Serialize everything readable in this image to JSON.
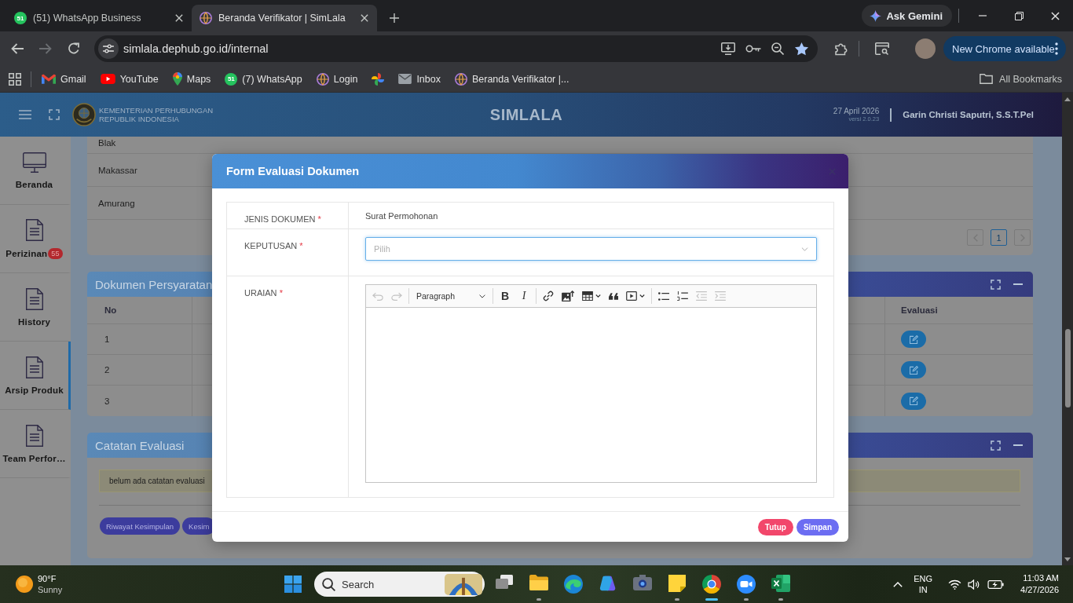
{
  "browser": {
    "tabs": [
      {
        "kind": "whatsapp",
        "badge": "51",
        "title": "(51) WhatsApp Business",
        "selected": false
      },
      {
        "kind": "site",
        "title": "Beranda Verifikator | SimLala",
        "selected": true
      }
    ],
    "gemini_button": "Ask Gemini",
    "navigation": {
      "back_disabled": false,
      "forward_disabled": true
    },
    "url": "simlala.dephub.go.id/internal",
    "bookmarked": true,
    "update_button": "New Chrome available",
    "bookmarks": [
      {
        "kind": "gmail",
        "label": "Gmail"
      },
      {
        "kind": "youtube",
        "label": "YouTube"
      },
      {
        "kind": "maps",
        "label": "Maps"
      },
      {
        "kind": "whatsapp",
        "badge": "51",
        "label": "(7) WhatsApp"
      },
      {
        "kind": "site",
        "label": "Login"
      },
      {
        "kind": "photos"
      },
      {
        "kind": "mail",
        "label": "Inbox"
      },
      {
        "kind": "site",
        "label": "Beranda Verifikator |..."
      }
    ],
    "all_bookmarks": "All Bookmarks"
  },
  "app": {
    "header": {
      "org_lines": [
        "KEMENTERIAN PERHUBUNGAN",
        "REPUBLIK INDONESIA"
      ],
      "title": "SIMLALA",
      "date": "27 April 2026",
      "version": "versi 2.0.23",
      "user": "Garin Christi Saputri, S.S.T.Pel"
    },
    "sidebar": [
      {
        "kind": "monitor",
        "label": "Beranda",
        "selected": false
      },
      {
        "kind": "document",
        "label": "Perizinan",
        "badge": "55",
        "selected": false
      },
      {
        "kind": "document",
        "label": "History",
        "selected": false
      },
      {
        "kind": "document",
        "label": "Arsip Produk",
        "selected": true
      },
      {
        "kind": "document",
        "label": "Team Perfor…",
        "selected": false
      }
    ],
    "location_rows": [
      "Blak",
      "Makassar",
      "Amurang"
    ],
    "pages": [
      {
        "label": "1",
        "selected": true
      }
    ],
    "documents_card": {
      "title": "Dokumen Persyaratan",
      "columns": {
        "number": "No",
        "evaluation": "Evaluasi"
      },
      "rows": [
        {
          "number": "1"
        },
        {
          "number": "2"
        },
        {
          "number": "3"
        }
      ]
    },
    "notes_card": {
      "title": "Catatan Evaluasi",
      "note": "belum ada catatan evaluasi",
      "buttons": [
        "Riwayat Kesimpulan",
        "Kesim"
      ]
    }
  },
  "modal": {
    "title": "Form Evaluasi Dokumen",
    "fields": [
      {
        "kind": "text",
        "label": "JENIS DOKUMEN",
        "mark": "*",
        "value": "Surat Permohonan"
      },
      {
        "kind": "select",
        "label": "KEPUTUSAN",
        "mark": "*",
        "placeholder": "Pilih",
        "focused": true
      },
      {
        "kind": "editor",
        "label": "URAIAN",
        "mark": "*",
        "toolbar_groups": [
          {
            "items": [
              {
                "kind": "undo",
                "disabled": true
              },
              {
                "kind": "redo",
                "disabled": true
              }
            ]
          },
          {
            "items": [
              {
                "kind": "heading",
                "label": "Paragraph",
                "disabled": false
              }
            ]
          },
          {
            "items": [
              {
                "kind": "bold",
                "label": "B",
                "disabled": false
              },
              {
                "kind": "italic",
                "label": "I",
                "disabled": false
              }
            ]
          },
          {
            "items": [
              {
                "kind": "link",
                "disabled": false
              },
              {
                "kind": "image",
                "disabled": false
              },
              {
                "kind": "table",
                "disabled": false
              },
              {
                "kind": "quote",
                "disabled": false
              },
              {
                "kind": "media",
                "disabled": false
              }
            ]
          },
          {
            "items": [
              {
                "kind": "bullets",
                "disabled": false
              },
              {
                "kind": "numbers",
                "disabled": false
              },
              {
                "kind": "outdent",
                "disabled": true
              },
              {
                "kind": "indent",
                "disabled": true
              }
            ]
          }
        ]
      }
    ],
    "buttons": [
      {
        "kind": "danger",
        "label": "Tutup"
      },
      {
        "kind": "primary",
        "label": "Simpan"
      }
    ]
  },
  "taskbar": {
    "weather": {
      "temperature": "90°F",
      "condition": "Sunny"
    },
    "search_placeholder": "Search",
    "apps": [
      {
        "kind": "taskview",
        "running": false,
        "selected": false
      },
      {
        "kind": "explorer",
        "running": true,
        "selected": false
      },
      {
        "kind": "edge",
        "running": false,
        "selected": false
      },
      {
        "kind": "copilot",
        "running": false,
        "selected": false
      },
      {
        "kind": "camera",
        "running": false,
        "selected": false
      },
      {
        "kind": "sticky",
        "running": true,
        "selected": false
      },
      {
        "kind": "chrome",
        "running": true,
        "selected": true
      },
      {
        "kind": "zoom",
        "running": true,
        "selected": false
      },
      {
        "kind": "excel",
        "running": true,
        "selected": false
      }
    ],
    "language": [
      "ENG",
      "IN"
    ],
    "time": "11:03 AM",
    "date": "4/27/2026"
  }
}
